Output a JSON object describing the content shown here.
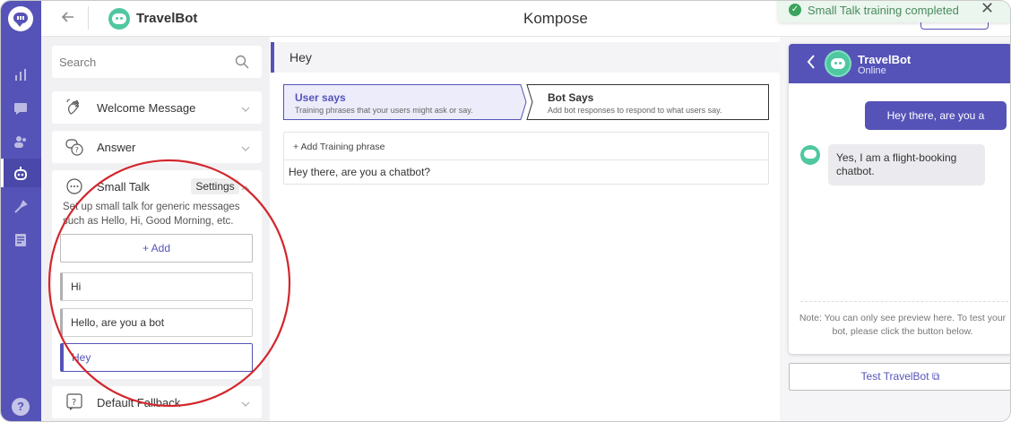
{
  "app": {
    "bot_name": "TravelBot",
    "page_title": "Kompose"
  },
  "toast": {
    "message": "Small Talk training completed",
    "close": "✕",
    "check": "✓"
  },
  "rail": {
    "help": "?"
  },
  "sidebar": {
    "search_placeholder": "Search",
    "sections": [
      {
        "label": "Welcome Message",
        "icon": "wave-hand-icon"
      },
      {
        "label": "Answer",
        "icon": "question-bubble-icon"
      },
      {
        "label": "Small Talk",
        "icon": "chat-dots-icon"
      },
      {
        "label": "Default Fallback",
        "icon": "question-box-icon"
      }
    ],
    "small_talk": {
      "settings_label": "Settings",
      "description": "Set up small talk for generic messages such as Hello, Hi, Good Morning, etc.",
      "add_label": "+ Add",
      "items": [
        "Hi",
        "Hello, are you a bot",
        "Hey"
      ],
      "active_index": 2
    }
  },
  "editor": {
    "intent_name": "Hey",
    "steps": [
      {
        "title": "User says",
        "subtitle": "Training phrases that your users might ask or say."
      },
      {
        "title": "Bot Says",
        "subtitle": "Add bot responses to respond to what users say."
      }
    ],
    "add_phrase_label": "+ Add Training phrase",
    "phrases": [
      "Hey there, are you a chatbot?"
    ]
  },
  "preview": {
    "bot_name": "TravelBot",
    "status": "Online",
    "messages": [
      {
        "from": "user",
        "text": "Hey there, are you a chatbot?"
      },
      {
        "from": "bot",
        "text": "Yes, I am a flight-booking chatbot."
      }
    ],
    "note": "Note: You can only see preview here. To test your bot, please click the button below.",
    "test_button": "Test TravelBot ⧉"
  },
  "colors": {
    "primary": "#5553b7",
    "accent_green": "#4fc7a0",
    "annotation_red": "#d2262c"
  }
}
